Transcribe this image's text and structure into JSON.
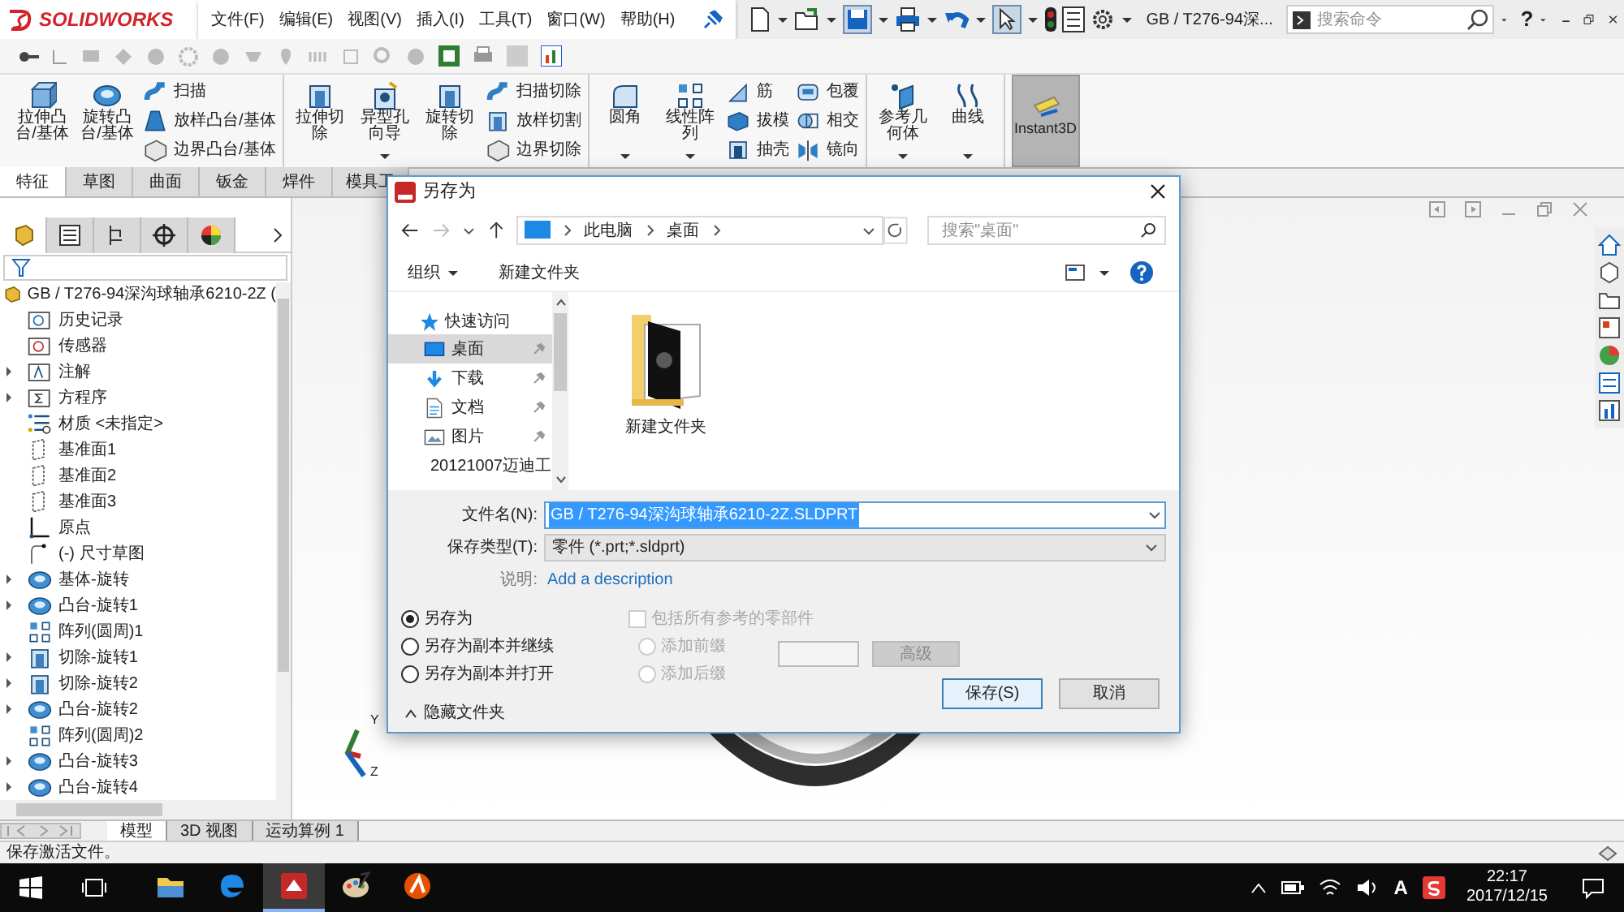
{
  "title_bar": {
    "logo": "SOLIDWORKS",
    "menus": [
      "文件(F)",
      "编辑(E)",
      "视图(V)",
      "插入(I)",
      "工具(T)",
      "窗口(W)",
      "帮助(H)"
    ],
    "document_title": "GB / T276-94深...",
    "search": {
      "placeholder": "搜索命令"
    },
    "help": "?"
  },
  "ribbon": {
    "groups": [
      {
        "large": [
          {
            "lines": [
              "拉伸凸",
              "台/基体"
            ],
            "kind": "boss",
            "dropdown": false
          },
          {
            "lines": [
              "旋转凸",
              "台/基体"
            ],
            "kind": "revolve",
            "dropdown": false
          }
        ],
        "small_columns": [
          [
            {
              "label": "扫描",
              "kind": "sweep"
            },
            {
              "label": "放样凸台/基体",
              "kind": "loft"
            },
            {
              "label": "边界凸台/基体",
              "kind": "boundary"
            }
          ]
        ]
      },
      {
        "large": [
          {
            "lines": [
              "拉伸切",
              "除"
            ],
            "kind": "cut",
            "dropdown": false
          },
          {
            "lines": [
              "异型孔",
              "向导"
            ],
            "kind": "hole",
            "dropdown": true
          },
          {
            "lines": [
              "旋转切",
              "除"
            ],
            "kind": "cut",
            "dropdown": false
          }
        ],
        "small_columns": [
          [
            {
              "label": "扫描切除",
              "kind": "sweep"
            },
            {
              "label": "放样切割",
              "kind": "cut"
            },
            {
              "label": "边界切除",
              "kind": "boundary"
            }
          ]
        ]
      },
      {
        "large": [
          {
            "lines": [
              "圆角"
            ],
            "kind": "fillet",
            "dropdown": true
          },
          {
            "lines": [
              "线性阵",
              "列"
            ],
            "kind": "pattern",
            "dropdown": true
          }
        ],
        "small_columns": [
          [
            {
              "label": "筋",
              "kind": "rib"
            },
            {
              "label": "拔模",
              "kind": "draft"
            },
            {
              "label": "抽壳",
              "kind": "shell"
            }
          ],
          [
            {
              "label": "包覆",
              "kind": "wrap"
            },
            {
              "label": "相交",
              "kind": "intersect"
            },
            {
              "label": "镜向",
              "kind": "mirror"
            }
          ]
        ]
      },
      {
        "large": [
          {
            "lines": [
              "参考几",
              "何体"
            ],
            "kind": "reference",
            "dropdown": true
          },
          {
            "lines": [
              "曲线"
            ],
            "kind": "curve",
            "dropdown": true
          }
        ]
      }
    ],
    "instant3d": {
      "label": "Instant3D",
      "on": true
    },
    "tabs": [
      {
        "label": "特征",
        "selected": true
      },
      {
        "label": "草图",
        "selected": false
      },
      {
        "label": "曲面",
        "selected": false
      },
      {
        "label": "钣金",
        "selected": false
      },
      {
        "label": "焊件",
        "selected": false
      },
      {
        "label": "模具工",
        "selected": false
      }
    ]
  },
  "feature_manager": {
    "panel_tabs": [
      {
        "kind": "feature",
        "selected": true
      },
      {
        "kind": "property",
        "selected": false
      },
      {
        "kind": "config",
        "selected": false
      },
      {
        "kind": "dimxpert",
        "selected": false
      },
      {
        "kind": "display",
        "selected": false
      }
    ],
    "root": "GB / T276-94深沟球轴承6210-2Z (",
    "items": [
      {
        "label": "历史记录",
        "kind": "history",
        "expandable": false
      },
      {
        "label": "传感器",
        "kind": "sensor",
        "expandable": false
      },
      {
        "label": "注解",
        "kind": "annotation",
        "expandable": true
      },
      {
        "label": "方程序",
        "kind": "equation",
        "expandable": true
      },
      {
        "label": "材质 <未指定>",
        "kind": "material",
        "expandable": false
      },
      {
        "label": "基准面1",
        "kind": "plane",
        "expandable": false
      },
      {
        "label": "基准面2",
        "kind": "plane",
        "expandable": false
      },
      {
        "label": "基准面3",
        "kind": "plane",
        "expandable": false
      },
      {
        "label": "原点",
        "kind": "origin",
        "expandable": false
      },
      {
        "label": "(-) 尺寸草图",
        "kind": "sketch",
        "expandable": false
      },
      {
        "label": "基体-旋转",
        "kind": "revolve",
        "expandable": true
      },
      {
        "label": "凸台-旋转1",
        "kind": "revolve",
        "expandable": true
      },
      {
        "label": "阵列(圆周)1",
        "kind": "pattern",
        "expandable": false
      },
      {
        "label": "切除-旋转1",
        "kind": "cut",
        "expandable": true
      },
      {
        "label": "切除-旋转2",
        "kind": "cut",
        "expandable": true
      },
      {
        "label": "凸台-旋转2",
        "kind": "revolve",
        "expandable": true
      },
      {
        "label": "阵列(圆周)2",
        "kind": "pattern",
        "expandable": false
      },
      {
        "label": "凸台-旋转3",
        "kind": "revolve",
        "expandable": true
      },
      {
        "label": "凸台-旋转4",
        "kind": "revolve",
        "expandable": true
      }
    ]
  },
  "viewport": {
    "triad": [
      "Y",
      "Z"
    ]
  },
  "bottom_tabs": [
    {
      "label": "模型",
      "selected": true
    },
    {
      "label": "3D 视图",
      "selected": false
    },
    {
      "label": "运动算例 1",
      "selected": false
    }
  ],
  "status_bar": "保存激活文件。",
  "dialog": {
    "title": "另存为",
    "breadcrumb": [
      "此电脑",
      "桌面"
    ],
    "search": {
      "placeholder": "搜索\"桌面\""
    },
    "toolbar": [
      "组织",
      "新建文件夹"
    ],
    "nav": {
      "header": "快速访问",
      "items": [
        {
          "label": "桌面",
          "kind": "desktop",
          "selected": true,
          "pinned": true
        },
        {
          "label": "下载",
          "kind": "download",
          "selected": false,
          "pinned": true
        },
        {
          "label": "文档",
          "kind": "document",
          "selected": false,
          "pinned": true
        },
        {
          "label": "图片",
          "kind": "picture",
          "selected": false,
          "pinned": true
        },
        {
          "label": "20121007迈迪工",
          "kind": "folder",
          "selected": false,
          "pinned": false
        }
      ]
    },
    "files": [
      {
        "name": "新建文件夹"
      }
    ],
    "file_name": {
      "label": "文件名(N):",
      "value": "GB / T276-94深沟球轴承6210-2Z.SLDPRT"
    },
    "file_type": {
      "label": "保存类型(T):",
      "value": "零件 (*.prt;*.sldprt)"
    },
    "description": {
      "label": "说明:",
      "link": "Add a description"
    },
    "save_modes": [
      {
        "label": "另存为",
        "selected": true
      },
      {
        "label": "另存为副本并继续",
        "selected": false
      },
      {
        "label": "另存为副本并打开",
        "selected": false
      }
    ],
    "include_refs": {
      "label": "包括所有参考的零部件",
      "checked": false,
      "disabled": true
    },
    "affixes": [
      {
        "label": "添加前缀",
        "selected": false
      },
      {
        "label": "添加后缀",
        "selected": false
      }
    ],
    "advanced": {
      "label": "高级",
      "disabled": true
    },
    "hide_folders": "隐藏文件夹",
    "buttons": [
      "保存(S)",
      "取消"
    ]
  },
  "taskbar": {
    "apps": [
      {
        "kind": "explorer",
        "active": false
      },
      {
        "kind": "edge",
        "active": false
      },
      {
        "kind": "solidworks",
        "active": true
      },
      {
        "kind": "paint",
        "active": false
      },
      {
        "kind": "autocad",
        "active": false
      }
    ],
    "ime": "A",
    "time": "22:17",
    "date": "2017/12/15"
  }
}
